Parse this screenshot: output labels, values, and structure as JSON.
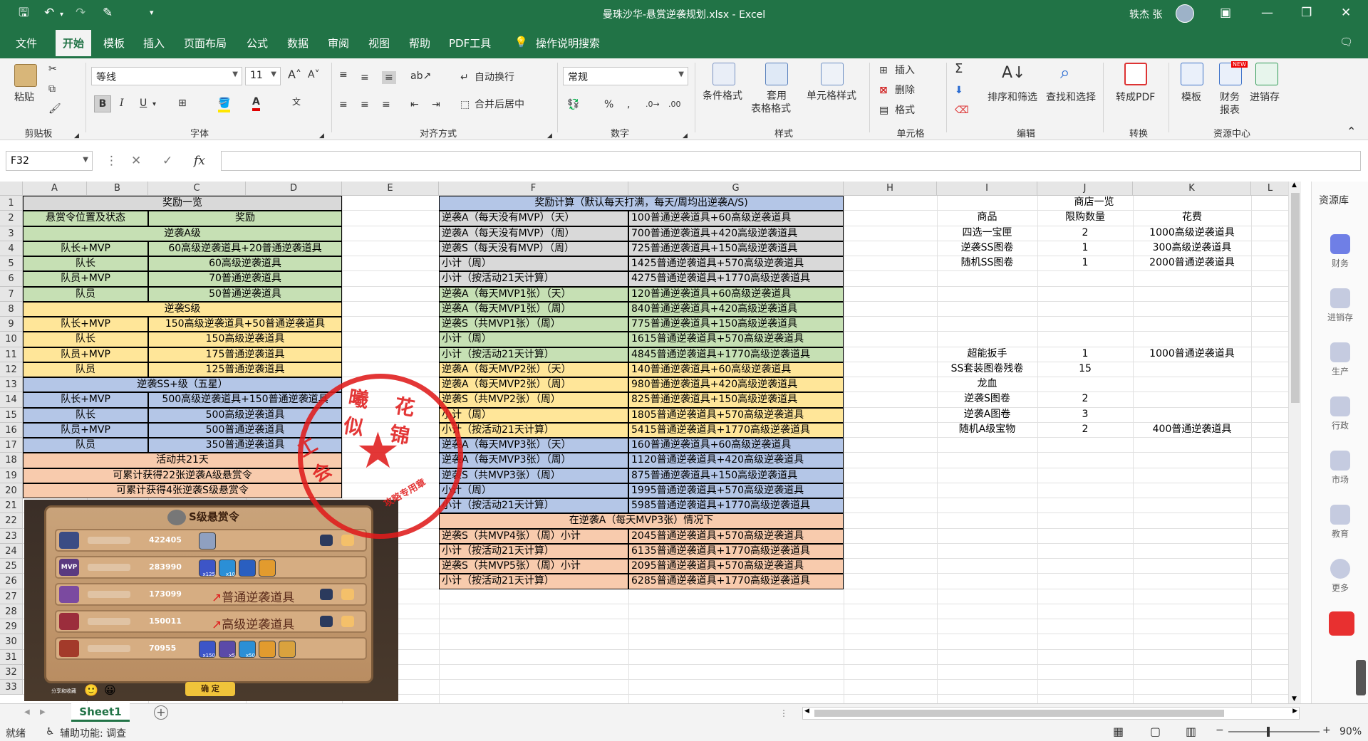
{
  "title": {
    "filename": "曼珠沙华-悬赏逆袭规划.xlsx",
    "app": "Excel",
    "user": "轶杰 张"
  },
  "menu": [
    "文件",
    "开始",
    "模板",
    "插入",
    "页面布局",
    "公式",
    "数据",
    "审阅",
    "视图",
    "帮助",
    "PDF工具",
    "操作说明搜索"
  ],
  "ribbon": {
    "paste": "粘贴",
    "font_name": "等线",
    "font_size": "11",
    "wrap": "自动换行",
    "merge": "合并后居中",
    "number_format": "常规",
    "cond_format": "条件格式",
    "table_format_1": "套用",
    "table_format_2": "表格格式",
    "cell_style": "单元格样式",
    "insert": "插入",
    "delete": "删除",
    "format": "格式",
    "sort_filter": "排序和筛选",
    "find_select": "查找和选择",
    "to_pdf": "转成PDF",
    "template": "模板",
    "finance_1": "财务",
    "finance_2": "报表",
    "jxc": "进销存",
    "new_badge": "NEW",
    "groups": [
      "剪贴板",
      "字体",
      "对齐方式",
      "数字",
      "样式",
      "单元格",
      "编辑",
      "转换",
      "资源中心"
    ]
  },
  "formula_bar": {
    "name_box": "F32",
    "fx": "fx",
    "value": ""
  },
  "columns": [
    "A",
    "B",
    "C",
    "D",
    "E",
    "F",
    "G",
    "H",
    "I",
    "J",
    "K",
    "L"
  ],
  "rows": [
    "1",
    "2",
    "3",
    "4",
    "5",
    "6",
    "7",
    "8",
    "9",
    "10",
    "11",
    "12",
    "13",
    "14",
    "15",
    "16",
    "17",
    "18",
    "19",
    "20",
    "21",
    "22",
    "23",
    "24",
    "25",
    "26",
    "27",
    "28",
    "29",
    "30",
    "31",
    "32",
    "33"
  ],
  "rewards": {
    "title": "奖励一览",
    "h1": "悬赏令位置及状态",
    "h2": "奖励",
    "rows": [
      {
        "span": "逆袭A级",
        "cls": "g"
      },
      {
        "a": "队长+MVP",
        "b": "60高级逆袭道具+20普通逆袭道具",
        "cls": "g"
      },
      {
        "a": "队长",
        "b": "60高级逆袭道具",
        "cls": "g"
      },
      {
        "a": "队员+MVP",
        "b": "70普通逆袭道具",
        "cls": "g"
      },
      {
        "a": "队员",
        "b": "50普通逆袭道具",
        "cls": "g"
      },
      {
        "span": "逆袭S级",
        "cls": "y"
      },
      {
        "a": "队长+MVP",
        "b": "150高级逆袭道具+50普通逆袭道具",
        "cls": "y"
      },
      {
        "a": "队长",
        "b": "150高级逆袭道具",
        "cls": "y"
      },
      {
        "a": "队员+MVP",
        "b": "175普通逆袭道具",
        "cls": "y"
      },
      {
        "a": "队员",
        "b": "125普通逆袭道具",
        "cls": "y"
      },
      {
        "span": "逆袭SS+级（五星）",
        "cls": "b"
      },
      {
        "a": "队长+MVP",
        "b": "500高级逆袭道具+150普通逆袭道具",
        "cls": "b"
      },
      {
        "a": "队长",
        "b": "500高级逆袭道具",
        "cls": "b"
      },
      {
        "a": "队员+MVP",
        "b": "500普通逆袭道具",
        "cls": "b"
      },
      {
        "a": "队员",
        "b": "350普通逆袭道具",
        "cls": "b"
      },
      {
        "span": "活动共21天",
        "cls": "o"
      },
      {
        "span": "可累计获得22张逆袭A级悬赏令",
        "cls": "o"
      },
      {
        "span": "可累计获得4张逆袭S级悬赏令",
        "cls": "o"
      }
    ]
  },
  "calc": {
    "title": "奖励计算（默认每天打满，每天/周均出逆袭A/S)",
    "rows": [
      {
        "f": "逆袭A（每天没有MVP）（天）",
        "g": "100普通逆袭道具+60高级逆袭道具",
        "cls": "gr"
      },
      {
        "f": "逆袭A（每天没有MVP）（周）",
        "g": "700普通逆袭道具+420高级逆袭道具",
        "cls": "gr"
      },
      {
        "f": "逆袭S（每天没有MVP）（周）",
        "g": "725普通逆袭道具+150高级逆袭道具",
        "cls": "gr"
      },
      {
        "f": "小计（周）",
        "g": "1425普通逆袭道具+570高级逆袭道具",
        "cls": "gr"
      },
      {
        "f": "小计（按活动21天计算）",
        "g": "4275普通逆袭道具+1770高级逆袭道具",
        "cls": "gr"
      },
      {
        "f": "逆袭A（每天MVP1张）（天）",
        "g": "120普通逆袭道具+60高级逆袭道具",
        "cls": "g"
      },
      {
        "f": "逆袭A（每天MVP1张）（周）",
        "g": "840普通逆袭道具+420高级逆袭道具",
        "cls": "g"
      },
      {
        "f": "逆袭S（共MVP1张）（周）",
        "g": "775普通逆袭道具+150高级逆袭道具",
        "cls": "g"
      },
      {
        "f": "小计（周）",
        "g": "1615普通逆袭道具+570高级逆袭道具",
        "cls": "g"
      },
      {
        "f": "小计（按活动21天计算）",
        "g": "4845普通逆袭道具+1770高级逆袭道具",
        "cls": "g"
      },
      {
        "f": "逆袭A（每天MVP2张）（天）",
        "g": "140普通逆袭道具+60高级逆袭道具",
        "cls": "y"
      },
      {
        "f": "逆袭A（每天MVP2张）（周）",
        "g": "980普通逆袭道具+420高级逆袭道具",
        "cls": "y"
      },
      {
        "f": "逆袭S（共MVP2张）（周）",
        "g": "825普通逆袭道具+150高级逆袭道具",
        "cls": "y"
      },
      {
        "f": "小计（周）",
        "g": "1805普通逆袭道具+570高级逆袭道具",
        "cls": "y"
      },
      {
        "f": "小计（按活动21天计算）",
        "g": "5415普通逆袭道具+1770高级逆袭道具",
        "cls": "y"
      },
      {
        "f": "逆袭A（每天MVP3张）（天）",
        "g": "160普通逆袭道具+60高级逆袭道具",
        "cls": "b"
      },
      {
        "f": "逆袭A（每天MVP3张）（周）",
        "g": "1120普通逆袭道具+420高级逆袭道具",
        "cls": "b"
      },
      {
        "f": "逆袭S（共MVP3张）（周）",
        "g": "875普通逆袭道具+150高级逆袭道具",
        "cls": "b"
      },
      {
        "f": "小计（周）",
        "g": "1995普通逆袭道具+570高级逆袭道具",
        "cls": "b"
      },
      {
        "f": "小计（按活动21天计算）",
        "g": "5985普通逆袭道具+1770高级逆袭道具",
        "cls": "b"
      },
      {
        "span": "在逆袭A（每天MVP3张）情况下",
        "cls": "o"
      },
      {
        "f": "逆袭S（共MVP4张）（周）小计",
        "g": "2045普通逆袭道具+570高级逆袭道具",
        "cls": "o"
      },
      {
        "f": "小计（按活动21天计算）",
        "g": "6135普通逆袭道具+1770高级逆袭道具",
        "cls": "o"
      },
      {
        "f": "逆袭S（共MVP5张）（周）小计",
        "g": "2095普通逆袭道具+570高级逆袭道具",
        "cls": "o"
      },
      {
        "f": "小计（按活动21天计算）",
        "g": "6285普通逆袭道具+1770高级逆袭道具",
        "cls": "o"
      }
    ]
  },
  "shop": {
    "title": "商店一览",
    "headers": [
      "商品",
      "限购数量",
      "花费"
    ],
    "rows": [
      {
        "r": 3,
        "i": "四选一宝匣",
        "j": "2",
        "k": "1000高级逆袭道具"
      },
      {
        "r": 4,
        "i": "逆袭SS图卷",
        "j": "1",
        "k": "300高级逆袭道具"
      },
      {
        "r": 5,
        "i": "随机SS图卷",
        "j": "1",
        "k": "2000普通逆袭道具"
      },
      {
        "r": 11,
        "i": "超能扳手",
        "j": "1",
        "k": "1000普通逆袭道具"
      },
      {
        "r": 12,
        "i": "SS套装图卷残卷",
        "j": "15",
        "k": ""
      },
      {
        "r": 13,
        "i": "龙血",
        "j": "",
        "k": ""
      },
      {
        "r": 14,
        "i": "逆袭S图卷",
        "j": "2",
        "k": ""
      },
      {
        "r": 15,
        "i": "逆袭A图卷",
        "j": "3",
        "k": ""
      },
      {
        "r": 16,
        "i": "随机A级宝物",
        "j": "2",
        "k": "400普通逆袭道具"
      }
    ]
  },
  "game": {
    "header": "S级悬赏令",
    "scores": [
      "422405",
      "283990",
      "173099",
      "150011",
      "70955"
    ],
    "mvp": "MVP",
    "item_counts": {
      "r2a": "x125",
      "r2b": "x10",
      "r5a": "x150",
      "r5b": "x5",
      "r5c": "x50"
    },
    "arrow_1": "普通逆袭道具",
    "arrow_2": "高级逆袭道具",
    "confirm": "确 定",
    "share": "分享和收藏"
  },
  "stamp": {
    "top": "曦 花 似 锦",
    "left": "工 会",
    "bottom": "攻略专用章"
  },
  "right_pane": {
    "title": "资源库",
    "items": [
      "财务",
      "进销存",
      "生产",
      "行政",
      "市场",
      "教育",
      "更多"
    ]
  },
  "sheet_tab": "Sheet1",
  "status": {
    "ready": "就绪",
    "accessibility": "辅助功能: 调查",
    "zoom": "90%"
  },
  "colors": {
    "excel_green": "#217346",
    "green_fill": "#c6e0b4",
    "yellow_fill": "#ffe699",
    "blue_fill": "#b4c6e7",
    "orange_fill": "#f8cbad",
    "gray_fill": "#d9d9d9",
    "stamp_red": "#e01c1c"
  }
}
